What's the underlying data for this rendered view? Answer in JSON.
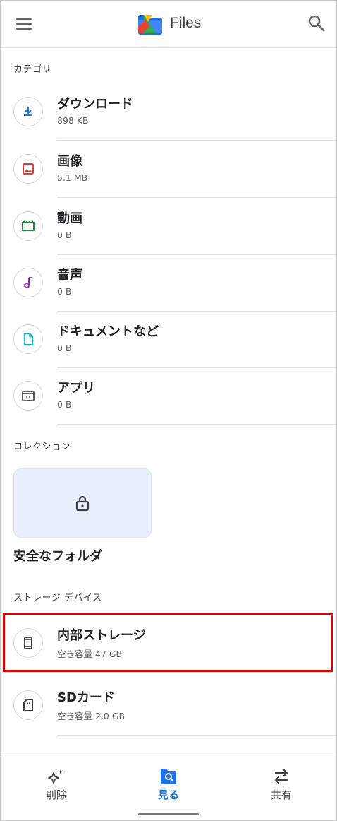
{
  "app": {
    "title": "Files"
  },
  "categories": {
    "header": "カテゴリ",
    "items": [
      {
        "name": "ダウンロード",
        "size": "898 KB",
        "icon": "download-icon",
        "color": "#1a73e8"
      },
      {
        "name": "画像",
        "size": "5.1 MB",
        "icon": "image-icon",
        "color": "#e53935"
      },
      {
        "name": "動画",
        "size": "0 B",
        "icon": "video-icon",
        "color": "#1e8e3e"
      },
      {
        "name": "音声",
        "size": "0 B",
        "icon": "audio-icon",
        "color": "#8e24aa"
      },
      {
        "name": "ドキュメントなど",
        "size": "0 B",
        "icon": "document-icon",
        "color": "#12b5cb"
      },
      {
        "name": "アプリ",
        "size": "0 B",
        "icon": "app-icon",
        "color": "#5f6368"
      }
    ]
  },
  "collections": {
    "header": "コレクション",
    "safe_folder_label": "安全なフォルダ"
  },
  "storage": {
    "header": "ストレージ デバイス",
    "items": [
      {
        "name": "内部ストレージ",
        "free": "空き容量 47 GB",
        "icon": "phone-icon",
        "highlighted": true
      },
      {
        "name": "SDカード",
        "free": "空き容量 2.0 GB",
        "icon": "sd-card-icon",
        "highlighted": false
      }
    ]
  },
  "bottom_nav": {
    "items": [
      {
        "label": "削除",
        "icon": "sparkle-icon",
        "active": false
      },
      {
        "label": "見る",
        "icon": "browse-icon",
        "active": true
      },
      {
        "label": "共有",
        "icon": "share-icon",
        "active": false
      }
    ]
  },
  "colors": {
    "accent": "#1a73e8",
    "highlight_border": "#e00000"
  }
}
